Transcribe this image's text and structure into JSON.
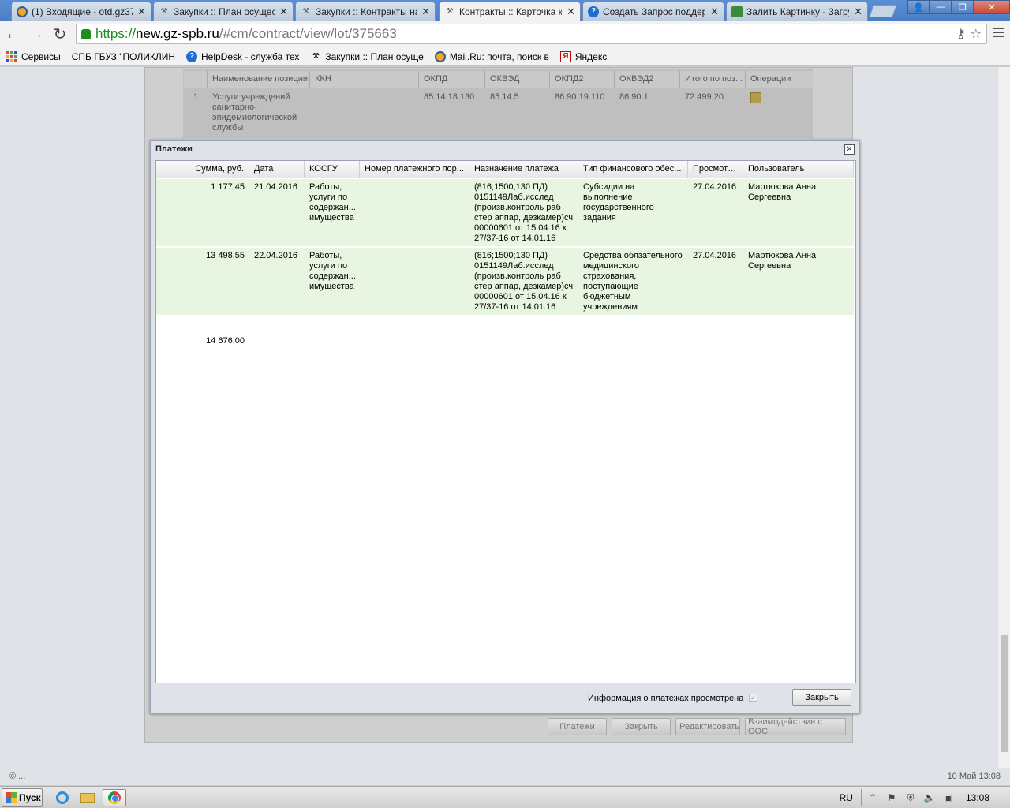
{
  "browser": {
    "tabs": [
      {
        "title": "(1) Входящие - otd.gz37(",
        "icon": "mail-icon"
      },
      {
        "title": "Закупки :: План осущест",
        "icon": "hammer-icon"
      },
      {
        "title": "Закупки :: Контракты на",
        "icon": "hammer-icon"
      },
      {
        "title": "Контракты :: Карточка к",
        "icon": "hammer-icon"
      },
      {
        "title": "Создать Запрос поддерж",
        "icon": "help-icon"
      },
      {
        "title": "Залить Картинку - Загру",
        "icon": "image-icon"
      }
    ],
    "url_scheme": "https://",
    "url_host": "new.gz-spb.ru",
    "url_path": "/#cm/contract/view/lot/375663",
    "bookmarks": [
      {
        "label": "Сервисы",
        "icon": "apps-icon"
      },
      {
        "label": "СПБ ГБУЗ \"ПОЛИКЛИН",
        "icon": "page-icon"
      },
      {
        "label": "HelpDesk - служба тех",
        "icon": "help-icon"
      },
      {
        "label": "Закупки :: План осуще",
        "icon": "hammer-icon"
      },
      {
        "label": "Mail.Ru: почта, поиск в",
        "icon": "mail-icon"
      },
      {
        "label": "Яндекс",
        "icon": "yandex-icon"
      }
    ]
  },
  "background_table": {
    "headers": [
      "Наименование позиции",
      "ККН",
      "ОКПД",
      "ОКВЭД",
      "ОКПД2",
      "ОКВЭД2",
      "Итого по поз...",
      "Операции"
    ],
    "row": {
      "num": "1",
      "name": "Услуги учреждений санитарно-эпидемиологической службы",
      "kkn": "",
      "okpd": "85.14.18.130",
      "okved": "85.14.5",
      "okpd2": "86.90.19.110",
      "okved2": "86.90.1",
      "total": "72 499,20"
    },
    "buttons": [
      "Платежи",
      "Закрыть",
      "Редактировать",
      "Взаимодействие с ООС"
    ]
  },
  "modal": {
    "title": "Платежи",
    "columns": [
      "Сумма, руб.",
      "Дата",
      "КОСГУ",
      "Номер платежного пор...",
      "Назначение платежа",
      "Тип финансового обес...",
      "Просмотр...",
      "Пользователь"
    ],
    "rows": [
      {
        "sum": "1 177,45",
        "date": "21.04.2016",
        "kosgu": "Работы, услуги по содержан... имущества",
        "order_num": "",
        "purpose": "(816;1500;130 ПД) 0151149Лаб.исслед (произв.контроль раб стер аппар, дезкамер)сч 00000601 от 15.04.16 к 27/37-16 от 14.01.16",
        "fin_type": "Субсидии на выполнение государственного задания",
        "viewed": "27.04.2016",
        "user": "Мартюкова Анна Сергеевна"
      },
      {
        "sum": "13 498,55",
        "date": "22.04.2016",
        "kosgu": "Работы, услуги по содержан... имущества",
        "order_num": "",
        "purpose": "(816;1500;130 ПД) 0151149Лаб.исслед (произв.контроль раб стер аппар, дезкамер)сч 00000601 от 15.04.16 к 27/37-16 от 14.01.16",
        "fin_type": "Средства обязательного медицинского страхования, поступающие бюджетным учреждениям",
        "viewed": "27.04.2016",
        "user": "Мартюкова Анна Сергеевна"
      }
    ],
    "total": "14 676,00",
    "checkbox_label": "Информация о платежах просмотрена",
    "checkbox_checked": true,
    "close_button": "Закрыть"
  },
  "status": {
    "left": "© ...",
    "right": "10 Май 13:08"
  },
  "taskbar": {
    "start_label": "Пуск",
    "lang": "RU",
    "clock": "13:08"
  }
}
